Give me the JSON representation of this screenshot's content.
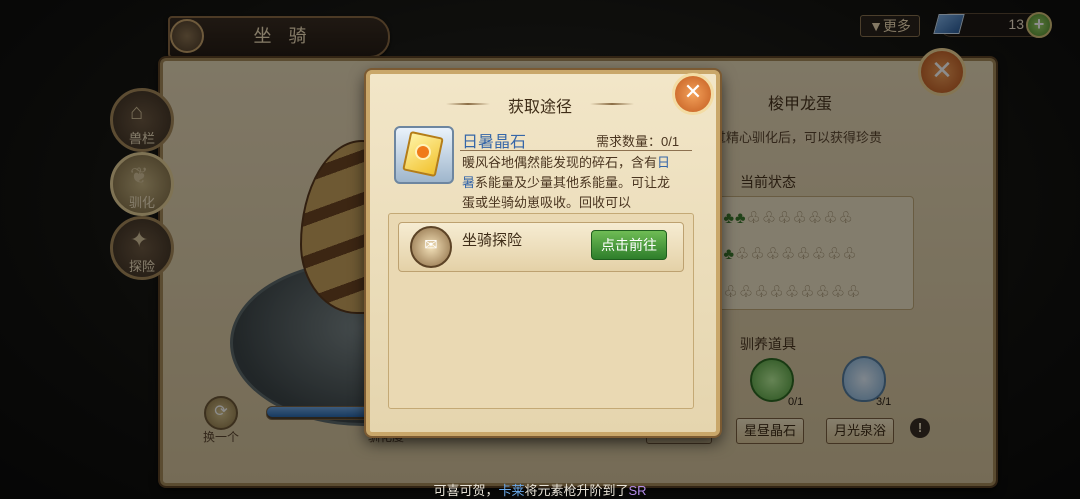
{
  "header": {
    "title": "坐 骑",
    "more_label": "▼更多",
    "currency_value": "13",
    "currency_plus": "+"
  },
  "side_tabs": [
    {
      "label": "兽栏",
      "icon": "stable-icon"
    },
    {
      "label": "驯化",
      "icon": "taming-icon",
      "active": true
    },
    {
      "label": "探险",
      "icon": "explore-icon"
    }
  ],
  "egg_panel": {
    "switch_label": "换一个",
    "progress_label": "驯化度"
  },
  "right_panel": {
    "title": "梭甲龙蛋",
    "desc": "经过精心驯化后，可以获得珍贵",
    "desc2": "…",
    "state_header": "当前状态",
    "clover_rows": [
      {
        "filled": 3,
        "total": 10
      },
      {
        "filled": 2,
        "total": 10
      },
      {
        "filled": 1,
        "total": 10
      }
    ],
    "items_header": "驯养道具",
    "items": [
      {
        "label": "日暑晶石",
        "count": ""
      },
      {
        "label": "星昼晶石",
        "count": "0/1"
      },
      {
        "label": "月光泉浴",
        "count": "3/1"
      }
    ],
    "info": "!"
  },
  "modal": {
    "title": "获取途径",
    "close": "✕",
    "item_name": "日暑晶石",
    "requirement": "需求数量：0/1",
    "desc_part1": "暖风谷地偶然能发现的碎石，含有",
    "desc_highlight": "日暑",
    "desc_part2": "系能量及少量其他系能量。可让龙蛋或坐骑幼崽吸收。回收可以",
    "sources": [
      {
        "name": "坐骑探险",
        "button": "点击前往"
      }
    ]
  },
  "footer": {
    "msg_prefix": "可喜可贺，",
    "msg_name": "卡莱",
    "msg_middle": "将元素枪升阶到了",
    "msg_rank": "SR"
  },
  "colors": {
    "accent_blue": "#3566a8",
    "go_button": "#2e7e2b",
    "close_orange": "#c25b1f"
  }
}
